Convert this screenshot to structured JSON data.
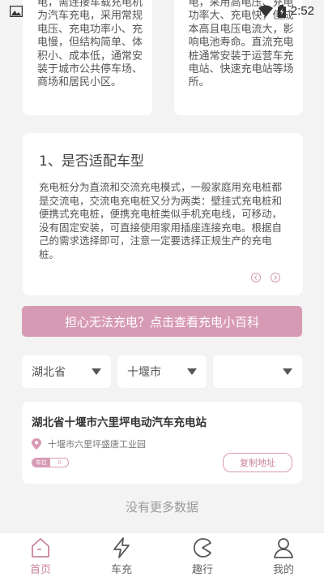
{
  "status": {
    "time": "2:52"
  },
  "top_cards": {
    "left_text": "电，需连接车载充电机为汽车充电，采用常规电压、充电功率小、充电慢，但结构简单、体积小、成本低，通常安装于城市公共停车场、商场和居民小区。",
    "right_text": "电，采用高电压、充电功率大、充电快，但成本高且电压电流大，影响电池寿命。直流充电桩通常安装于运营车充电站、快速充电站等场所。"
  },
  "info": {
    "title": "1、是否适配车型",
    "body": "充电桩分为直流和交流充电模式，一般家庭用充电桩都是交流电，交流电充电桩又分为两类：壁挂式充电桩和便携式充电桩，便携充电桩类似手机充电线，可移动，没有固定安装，可直接使用家用插座连接充电。根据自己的需求选择即可，注意一定要选择正规生产的充电桩。"
  },
  "banner": {
    "label": "担心无法充电？点击查看充电小百科"
  },
  "filters": {
    "province": "湖北省",
    "city": "十堰市",
    "district": ""
  },
  "station": {
    "name": "湖北省十堰市六里坪电动汽车充电站",
    "address": "十堰市六里坪盛唐工业园",
    "badge_left": "车位",
    "badge_right": "0",
    "copy_label": "复制地址"
  },
  "no_more": "没有更多数据",
  "tabs": [
    {
      "label": "首页",
      "icon": "home-icon",
      "active": true
    },
    {
      "label": "车充",
      "icon": "lightning-icon",
      "active": false
    },
    {
      "label": "趣行",
      "icon": "pacman-icon",
      "active": false
    },
    {
      "label": "我的",
      "icon": "user-icon",
      "active": false
    }
  ],
  "colors": {
    "accent": "#d79ab4",
    "background": "#f3f3f3"
  }
}
